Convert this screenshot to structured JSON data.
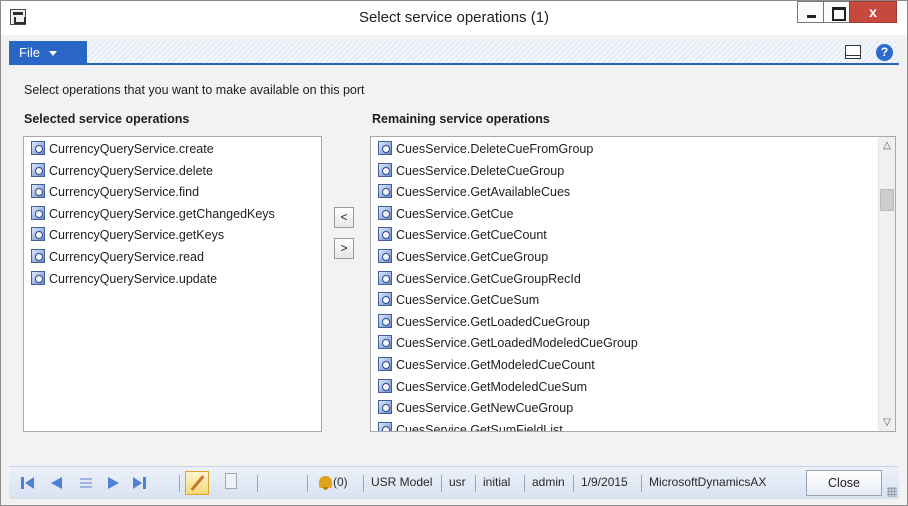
{
  "window": {
    "title": "Select service operations (1)",
    "close_glyph": "x"
  },
  "ribbon": {
    "file_label": "File"
  },
  "instruction": "Select operations that you want to make available on this port",
  "selected": {
    "header": "Selected service operations",
    "items": [
      "CurrencyQueryService.create",
      "CurrencyQueryService.delete",
      "CurrencyQueryService.find",
      "CurrencyQueryService.getChangedKeys",
      "CurrencyQueryService.getKeys",
      "CurrencyQueryService.read",
      "CurrencyQueryService.update"
    ]
  },
  "move_buttons": {
    "left": "<",
    "right": ">"
  },
  "remaining": {
    "header": "Remaining service operations",
    "items": [
      "CuesService.DeleteCueFromGroup",
      "CuesService.DeleteCueGroup",
      "CuesService.GetAvailableCues",
      "CuesService.GetCue",
      "CuesService.GetCueCount",
      "CuesService.GetCueGroup",
      "CuesService.GetCueGroupRecId",
      "CuesService.GetCueSum",
      "CuesService.GetLoadedCueGroup",
      "CuesService.GetLoadedModeledCueGroup",
      "CuesService.GetModeledCueCount",
      "CuesService.GetModeledCueSum",
      "CuesService.GetNewCueGroup",
      "CuesService.GetSumFieldList"
    ]
  },
  "statusbar": {
    "notifications": "(0)",
    "model": "USR Model",
    "layer": "usr",
    "currency_or_state": "initial",
    "user": "admin",
    "date": "1/9/2015",
    "partition": "MicrosoftDynamicsAX",
    "close_label": "Close"
  },
  "icons": {
    "app": "dynamics-ax-icon",
    "operation": "service-operation-icon",
    "help": "help-icon",
    "notification": "bell-icon"
  },
  "colors": {
    "file_button": "#2a66c5",
    "close_window": "#c7483d",
    "nav_arrows": "#4e82d9"
  }
}
